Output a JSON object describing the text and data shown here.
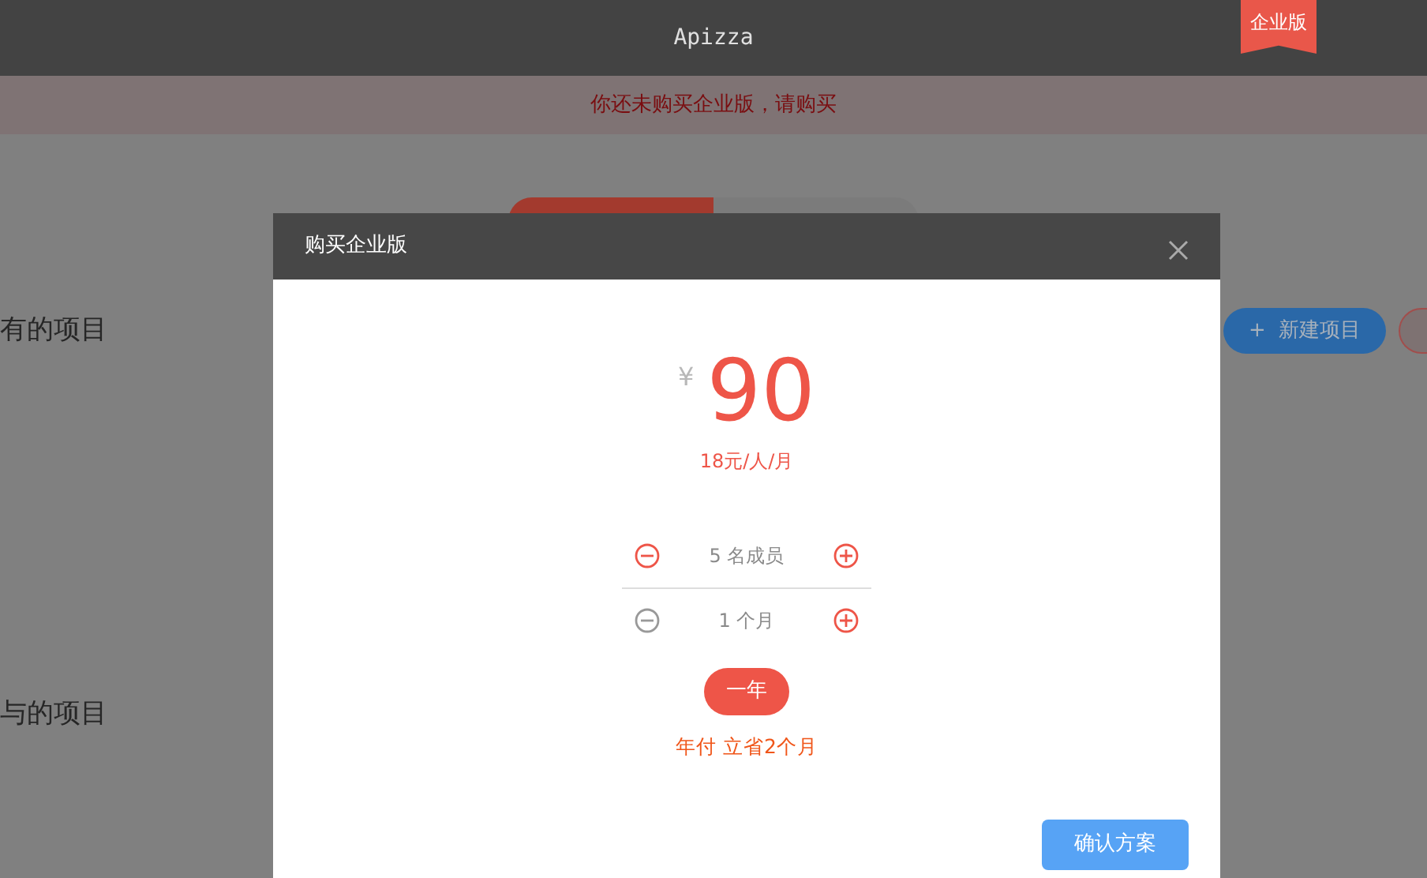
{
  "header": {
    "title": "Apizza",
    "edition_badge": "企业版"
  },
  "notice": "你还未购买企业版，请购买",
  "tabs": [
    {
      "selected": true
    },
    {
      "selected": false
    }
  ],
  "sections": [
    {
      "heading": "有的项目"
    },
    {
      "heading": "与的项目"
    }
  ],
  "new_project_button": {
    "icon": "+",
    "label": "新建项目"
  },
  "modal": {
    "title": "购买企业版",
    "currency": "¥",
    "price": "90",
    "unit_price": "18元/人/月",
    "steppers": [
      {
        "value": "5 名成员",
        "minus_disabled": false
      },
      {
        "value": "1 个月",
        "minus_disabled": true
      }
    ],
    "period_button": "一年",
    "discount_note": "年付 立省2个月",
    "confirm_button": "确认方案"
  }
}
